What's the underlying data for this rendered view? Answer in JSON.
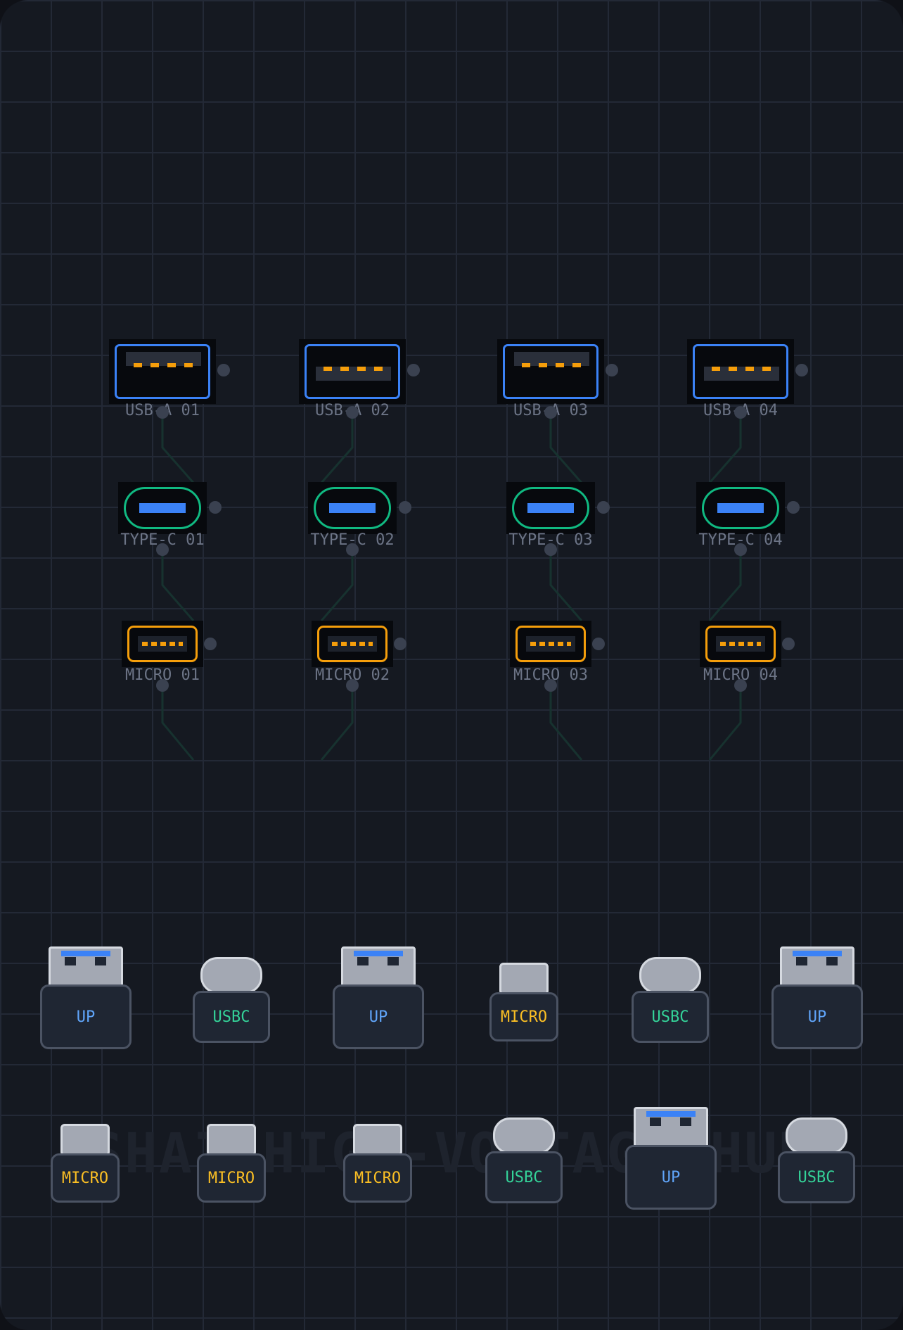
{
  "title": "SHAI HIGH-VOLTAGE HUB",
  "colors": {
    "usb_a": "#3b82f6",
    "type_c": "#10b981",
    "micro": "#f59e0b",
    "wire": "#17322f"
  },
  "ports": {
    "usba": [
      {
        "label": "USB-A 01"
      },
      {
        "label": "USB-A 02"
      },
      {
        "label": "USB-A 03"
      },
      {
        "label": "USB-A 04"
      }
    ],
    "typec": [
      {
        "label": "TYPE-C 01"
      },
      {
        "label": "TYPE-C 02"
      },
      {
        "label": "TYPE-C 03"
      },
      {
        "label": "TYPE-C 04"
      }
    ],
    "micro": [
      {
        "label": "MICRO 01"
      },
      {
        "label": "MICRO 02"
      },
      {
        "label": "MICRO 03"
      },
      {
        "label": "MICRO 04"
      }
    ]
  },
  "cables": {
    "row1": [
      {
        "type": "up",
        "label": "UP"
      },
      {
        "type": "usbc",
        "label": "USBC"
      },
      {
        "type": "up",
        "label": "UP"
      },
      {
        "type": "micro",
        "label": "MICRO"
      },
      {
        "type": "usbc",
        "label": "USBC"
      },
      {
        "type": "up",
        "label": "UP"
      }
    ],
    "row2": [
      {
        "type": "micro",
        "label": "MICRO"
      },
      {
        "type": "micro",
        "label": "MICRO"
      },
      {
        "type": "micro",
        "label": "MICRO"
      },
      {
        "type": "usbc",
        "label": "USBC"
      },
      {
        "type": "up",
        "label": "UP"
      },
      {
        "type": "usbc",
        "label": "USBC"
      }
    ]
  }
}
